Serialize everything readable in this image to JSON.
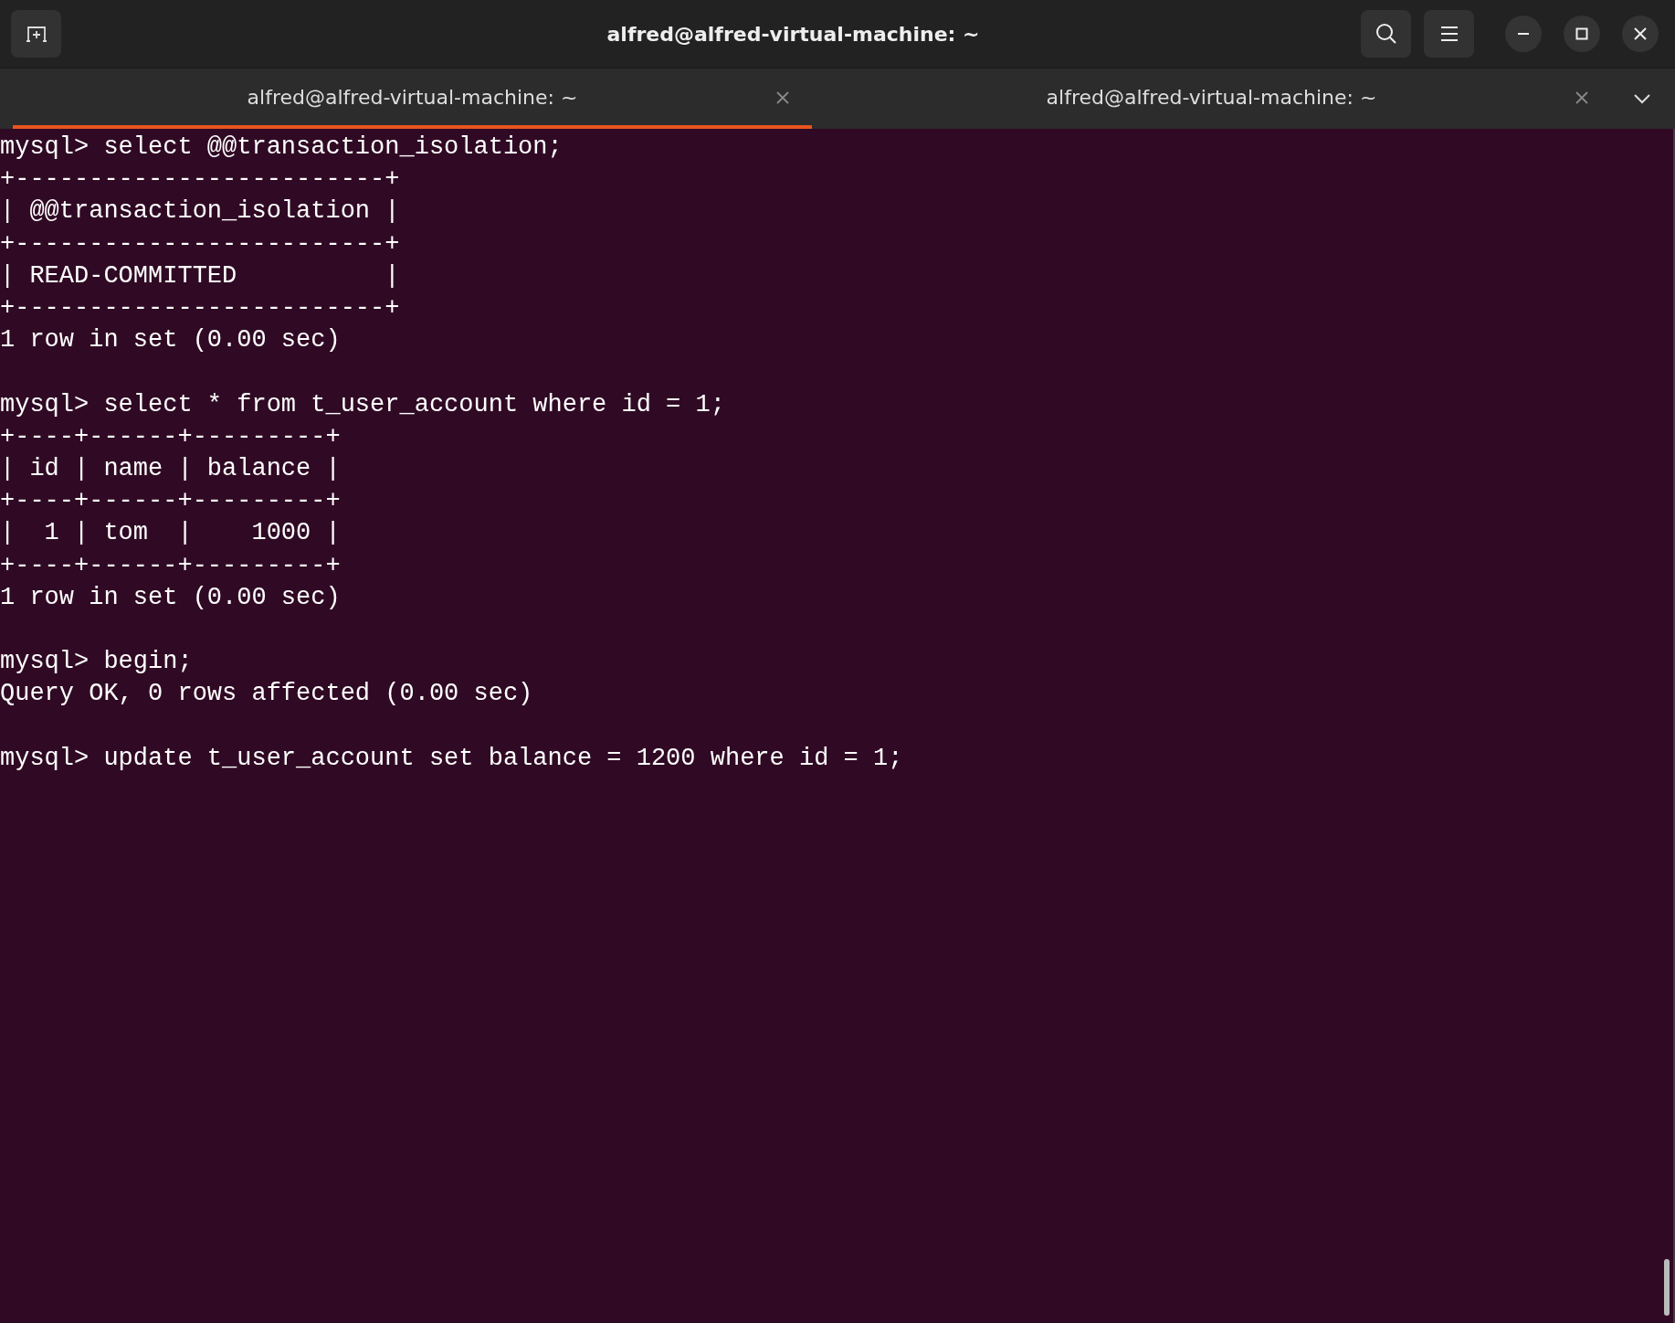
{
  "window": {
    "title": "alfred@alfred-virtual-machine: ~"
  },
  "tabs": [
    {
      "label": "alfred@alfred-virtual-machine: ~",
      "selected": true
    },
    {
      "label": "alfred@alfred-virtual-machine: ~",
      "selected": false
    }
  ],
  "terminal": {
    "blocks": [
      [
        "mysql> select @@transaction_isolation;",
        "+-------------------------+",
        "| @@transaction_isolation |",
        "+-------------------------+",
        "| READ-COMMITTED          |",
        "+-------------------------+",
        "1 row in set (0.00 sec)"
      ],
      [
        "mysql> select * from t_user_account where id = 1;",
        "+----+------+---------+",
        "| id | name | balance |",
        "+----+------+---------+",
        "|  1 | tom  |    1000 |",
        "+----+------+---------+",
        "1 row in set (0.00 sec)"
      ],
      [
        "mysql> begin;",
        "Query OK, 0 rows affected (0.00 sec)"
      ],
      [
        "mysql> update t_user_account set balance = 1200 where id = 1;"
      ]
    ]
  }
}
